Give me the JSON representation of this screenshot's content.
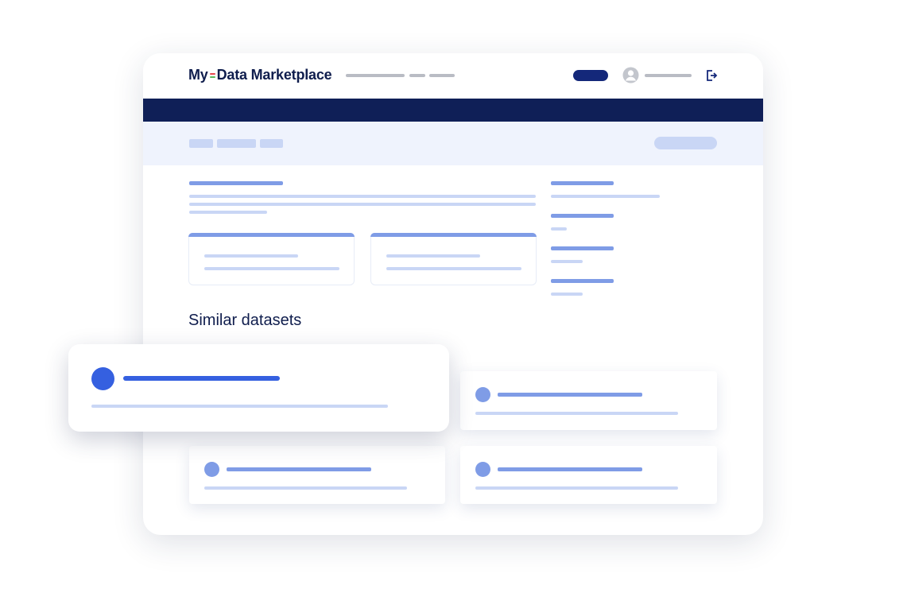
{
  "header": {
    "logo_part1": "My",
    "logo_part2": "Data Marketplace",
    "logo_mark_colors": [
      "#e8484f",
      "#5cb85c"
    ],
    "user_icon": "user-avatar-icon",
    "logout_icon": "logout-icon"
  },
  "content": {
    "similar_title": "Similar datasets"
  },
  "colors": {
    "navy": "#0f1f57",
    "accent_blue": "#3560e0",
    "muted_blue": "#7f9ce6",
    "light_blue": "#c9d6f5",
    "subbar_bg": "#eff3fd"
  }
}
